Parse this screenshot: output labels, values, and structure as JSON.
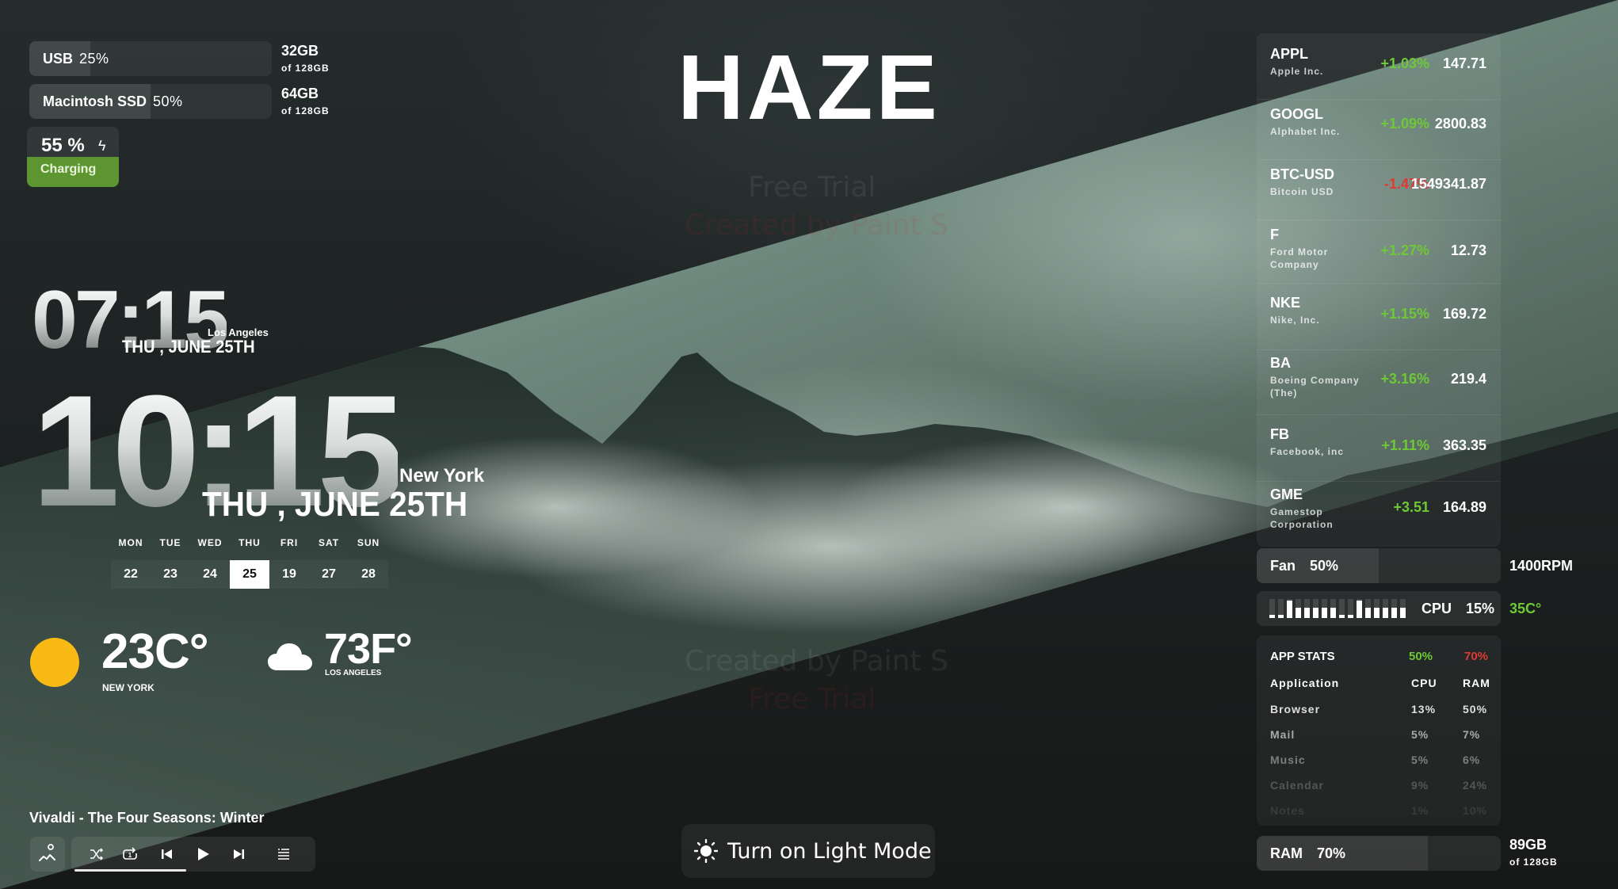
{
  "app": {
    "title": "HAZE",
    "watermarks": [
      "Free Trial",
      "Created by Paint S",
      "Created by Paint S",
      "Free Trial"
    ]
  },
  "storage": [
    {
      "name": "USB",
      "percent_label": "25%",
      "fraction": 0.25,
      "used": "32GB",
      "total": "of 128GB"
    },
    {
      "name": "Macintosh SSD",
      "percent_label": "50%",
      "fraction": 0.5,
      "used": "64GB",
      "total": "of 128GB"
    }
  ],
  "battery": {
    "percent_label": "55 %",
    "status": "Charging",
    "bolt_icon": "ϟ",
    "color": "#5d9631"
  },
  "clocks": {
    "secondary": {
      "time": "07:15",
      "city": "Los Angeles",
      "date": "THU , JUNE 25TH"
    },
    "primary": {
      "time": "10:15",
      "city": "New York",
      "date": "THU , JUNE 25TH"
    }
  },
  "calendar": {
    "weekdays": [
      "MON",
      "TUE",
      "WED",
      "THU",
      "FRI",
      "SAT",
      "SUN"
    ],
    "days": [
      "22",
      "23",
      "24",
      "25",
      "19",
      "27",
      "28"
    ],
    "today_index": 3
  },
  "weather": [
    {
      "icon": "sun-icon",
      "temp": "23C°",
      "city": "NEW YORK",
      "color": "#f9b914"
    },
    {
      "icon": "cloud-icon",
      "temp": "73F°",
      "city": "LOS ANGELES"
    }
  ],
  "music": {
    "track": "Vivaldi - The Four Seasons: Winter",
    "progress": 0.47,
    "controls": [
      "shuffle",
      "repeat-one",
      "previous",
      "play",
      "next",
      "playlist"
    ]
  },
  "light_mode_button": {
    "label": "Turn on Light Mode",
    "icon": "sun-icon"
  },
  "stocks": [
    {
      "symbol": "APPL",
      "name": "Apple Inc.",
      "change": "+1.03%",
      "price": "147.71",
      "direction": "up"
    },
    {
      "symbol": "GOOGL",
      "name": "Alphabet Inc.",
      "change": "+1.09%",
      "price": "2800.83",
      "direction": "up"
    },
    {
      "symbol": "BTC-USD",
      "name": "Bitcoin USD",
      "change": "-1.47%",
      "price": "1549341.87",
      "direction": "down"
    },
    {
      "symbol": "F",
      "name": "Ford Motor Company",
      "change": "+1.27%",
      "price": "12.73",
      "direction": "up"
    },
    {
      "symbol": "NKE",
      "name": "Nike, Inc.",
      "change": "+1.15%",
      "price": "169.72",
      "direction": "up"
    },
    {
      "symbol": "BA",
      "name": "Boeing Company (The)",
      "change": "+3.16%",
      "price": "219.4",
      "direction": "up"
    },
    {
      "symbol": "FB",
      "name": "Facebook, inc",
      "change": "+1.11%",
      "price": "363.35",
      "direction": "up"
    },
    {
      "symbol": "GME",
      "name": "Gamestop Corporation",
      "change": "+3.51",
      "price": "164.89",
      "direction": "up"
    }
  ],
  "colors": {
    "positive": "#6ec936",
    "negative": "#e03a32"
  },
  "fan": {
    "label": "Fan",
    "percent_label": "50%",
    "fraction": 0.5,
    "rpm": "1400RPM"
  },
  "cpu": {
    "label": "CPU",
    "percent_label": "15%",
    "temperature": "35C°",
    "history": [
      0.15,
      0.15,
      0.9,
      0.55,
      0.55,
      0.55,
      0.55,
      0.55,
      0.15,
      0.15,
      0.9,
      0.55,
      0.55,
      0.55,
      0.55,
      0.55
    ]
  },
  "app_stats": {
    "title": "APP STATS",
    "cpu_total": "50%",
    "ram_total": "70%",
    "headers": [
      "Application",
      "CPU",
      "RAM"
    ],
    "rows": [
      {
        "app": "Browser",
        "cpu": "13%",
        "ram": "50%"
      },
      {
        "app": "Mail",
        "cpu": "5%",
        "ram": "7%"
      },
      {
        "app": "Music",
        "cpu": "5%",
        "ram": "6%"
      },
      {
        "app": "Calendar",
        "cpu": "9%",
        "ram": "24%"
      },
      {
        "app": "Notes",
        "cpu": "1%",
        "ram": "10%"
      }
    ]
  },
  "ram": {
    "label": "RAM",
    "percent_label": "70%",
    "fraction": 0.7,
    "used": "89GB",
    "total": "of 128GB"
  }
}
